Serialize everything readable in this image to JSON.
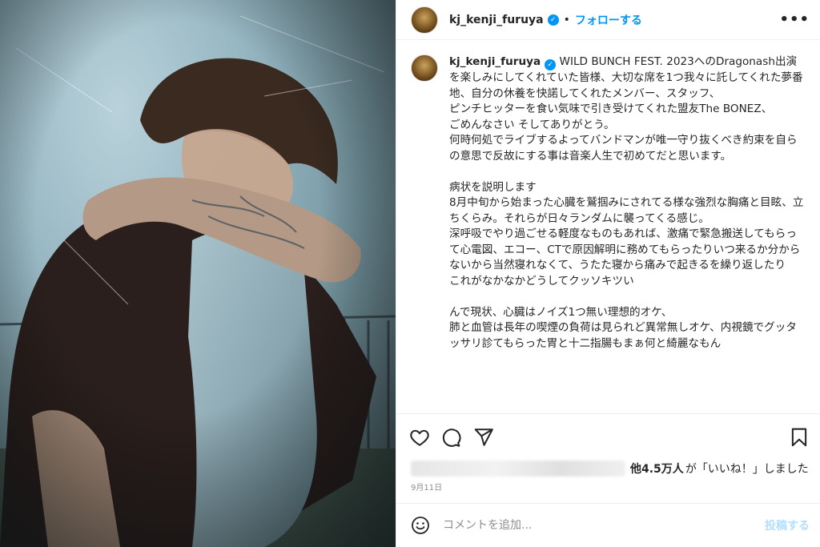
{
  "post": {
    "username": "kj_kenji_furuya",
    "verified_icon": "verified-badge-icon",
    "separator": "•",
    "follow_label": "フォローする",
    "more_icon": "more-options-icon",
    "caption_text": "WILD BUNCH FEST. 2023へのDragonash出演を楽しみにしてくれていた皆様、大切な席を1つ我々に託してくれた夢番地、自分の休養を快諾してくれたメンバー、スタッフ、\nピンチヒッターを食い気味で引き受けてくれた盟友The BONEZ、\nごめんなさい そしてありがとう。\n何時何処でライブするよってバンドマンが唯一守り抜くべき約束を自らの意思で反故にする事は音楽人生で初めてだと思います。\n\n病状を説明します\n8月中旬から始まった心臓を鷲掴みにされてる様な強烈な胸痛と目眩、立ちくらみ。それらが日々ランダムに襲ってくる感じ。\n深呼吸でやり過ごせる軽度なものもあれば、激痛で緊急搬送してもらって心電図、エコー、CTで原因解明に務めてもらったりいつ来るか分からないから当然寝れなくて、うたた寝から痛みで起きるを繰り返したり\nこれがなかなかどうしてクッソキツい\n\nんで現状、心臓はノイズ1つ無い理想的オケ、\n肺と血管は長年の喫煙の負荷は見られど異常無しオケ、内視鏡でグッタッサリ診てもらった胃と十二指腸もまぁ何と綺麗なもん",
    "likes_count": "他4.5万人",
    "likes_suffix": "が「いいね！」しました",
    "date": "9月11日",
    "comment_placeholder": "コメントを追加...",
    "post_button": "投稿する"
  },
  "icons": {
    "like": "heart-icon",
    "comment": "comment-bubble-icon",
    "share": "paper-plane-icon",
    "save": "bookmark-icon",
    "emoji": "emoji-icon"
  },
  "colors": {
    "accent": "#0095f6",
    "text": "#262626",
    "muted": "#8e8e8e",
    "border": "#efefef",
    "post_disabled": "#b2dffc"
  }
}
